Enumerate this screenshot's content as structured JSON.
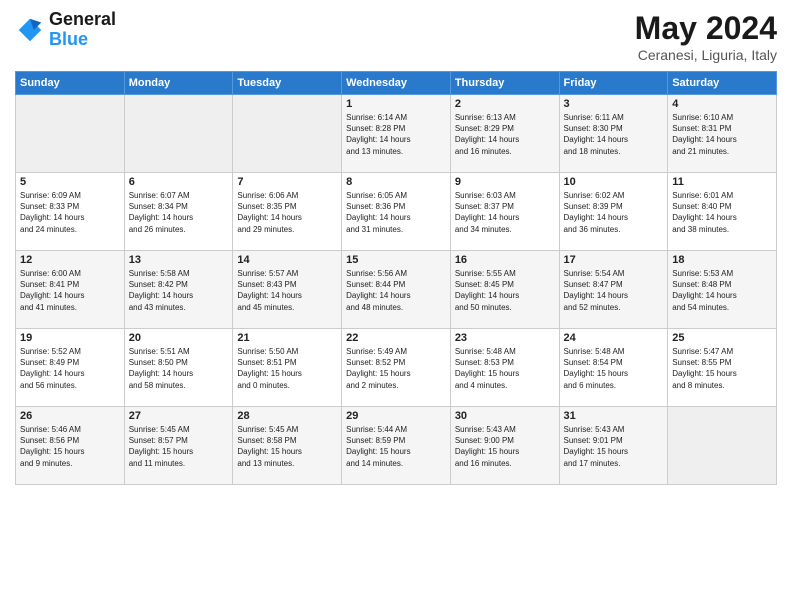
{
  "header": {
    "logo_text_general": "General",
    "logo_text_blue": "Blue",
    "title": "May 2024",
    "subtitle": "Ceranesi, Liguria, Italy"
  },
  "weekdays": [
    "Sunday",
    "Monday",
    "Tuesday",
    "Wednesday",
    "Thursday",
    "Friday",
    "Saturday"
  ],
  "weeks": [
    [
      {
        "day": "",
        "info": ""
      },
      {
        "day": "",
        "info": ""
      },
      {
        "day": "",
        "info": ""
      },
      {
        "day": "1",
        "info": "Sunrise: 6:14 AM\nSunset: 8:28 PM\nDaylight: 14 hours\nand 13 minutes."
      },
      {
        "day": "2",
        "info": "Sunrise: 6:13 AM\nSunset: 8:29 PM\nDaylight: 14 hours\nand 16 minutes."
      },
      {
        "day": "3",
        "info": "Sunrise: 6:11 AM\nSunset: 8:30 PM\nDaylight: 14 hours\nand 18 minutes."
      },
      {
        "day": "4",
        "info": "Sunrise: 6:10 AM\nSunset: 8:31 PM\nDaylight: 14 hours\nand 21 minutes."
      }
    ],
    [
      {
        "day": "5",
        "info": "Sunrise: 6:09 AM\nSunset: 8:33 PM\nDaylight: 14 hours\nand 24 minutes."
      },
      {
        "day": "6",
        "info": "Sunrise: 6:07 AM\nSunset: 8:34 PM\nDaylight: 14 hours\nand 26 minutes."
      },
      {
        "day": "7",
        "info": "Sunrise: 6:06 AM\nSunset: 8:35 PM\nDaylight: 14 hours\nand 29 minutes."
      },
      {
        "day": "8",
        "info": "Sunrise: 6:05 AM\nSunset: 8:36 PM\nDaylight: 14 hours\nand 31 minutes."
      },
      {
        "day": "9",
        "info": "Sunrise: 6:03 AM\nSunset: 8:37 PM\nDaylight: 14 hours\nand 34 minutes."
      },
      {
        "day": "10",
        "info": "Sunrise: 6:02 AM\nSunset: 8:39 PM\nDaylight: 14 hours\nand 36 minutes."
      },
      {
        "day": "11",
        "info": "Sunrise: 6:01 AM\nSunset: 8:40 PM\nDaylight: 14 hours\nand 38 minutes."
      }
    ],
    [
      {
        "day": "12",
        "info": "Sunrise: 6:00 AM\nSunset: 8:41 PM\nDaylight: 14 hours\nand 41 minutes."
      },
      {
        "day": "13",
        "info": "Sunrise: 5:58 AM\nSunset: 8:42 PM\nDaylight: 14 hours\nand 43 minutes."
      },
      {
        "day": "14",
        "info": "Sunrise: 5:57 AM\nSunset: 8:43 PM\nDaylight: 14 hours\nand 45 minutes."
      },
      {
        "day": "15",
        "info": "Sunrise: 5:56 AM\nSunset: 8:44 PM\nDaylight: 14 hours\nand 48 minutes."
      },
      {
        "day": "16",
        "info": "Sunrise: 5:55 AM\nSunset: 8:45 PM\nDaylight: 14 hours\nand 50 minutes."
      },
      {
        "day": "17",
        "info": "Sunrise: 5:54 AM\nSunset: 8:47 PM\nDaylight: 14 hours\nand 52 minutes."
      },
      {
        "day": "18",
        "info": "Sunrise: 5:53 AM\nSunset: 8:48 PM\nDaylight: 14 hours\nand 54 minutes."
      }
    ],
    [
      {
        "day": "19",
        "info": "Sunrise: 5:52 AM\nSunset: 8:49 PM\nDaylight: 14 hours\nand 56 minutes."
      },
      {
        "day": "20",
        "info": "Sunrise: 5:51 AM\nSunset: 8:50 PM\nDaylight: 14 hours\nand 58 minutes."
      },
      {
        "day": "21",
        "info": "Sunrise: 5:50 AM\nSunset: 8:51 PM\nDaylight: 15 hours\nand 0 minutes."
      },
      {
        "day": "22",
        "info": "Sunrise: 5:49 AM\nSunset: 8:52 PM\nDaylight: 15 hours\nand 2 minutes."
      },
      {
        "day": "23",
        "info": "Sunrise: 5:48 AM\nSunset: 8:53 PM\nDaylight: 15 hours\nand 4 minutes."
      },
      {
        "day": "24",
        "info": "Sunrise: 5:48 AM\nSunset: 8:54 PM\nDaylight: 15 hours\nand 6 minutes."
      },
      {
        "day": "25",
        "info": "Sunrise: 5:47 AM\nSunset: 8:55 PM\nDaylight: 15 hours\nand 8 minutes."
      }
    ],
    [
      {
        "day": "26",
        "info": "Sunrise: 5:46 AM\nSunset: 8:56 PM\nDaylight: 15 hours\nand 9 minutes."
      },
      {
        "day": "27",
        "info": "Sunrise: 5:45 AM\nSunset: 8:57 PM\nDaylight: 15 hours\nand 11 minutes."
      },
      {
        "day": "28",
        "info": "Sunrise: 5:45 AM\nSunset: 8:58 PM\nDaylight: 15 hours\nand 13 minutes."
      },
      {
        "day": "29",
        "info": "Sunrise: 5:44 AM\nSunset: 8:59 PM\nDaylight: 15 hours\nand 14 minutes."
      },
      {
        "day": "30",
        "info": "Sunrise: 5:43 AM\nSunset: 9:00 PM\nDaylight: 15 hours\nand 16 minutes."
      },
      {
        "day": "31",
        "info": "Sunrise: 5:43 AM\nSunset: 9:01 PM\nDaylight: 15 hours\nand 17 minutes."
      },
      {
        "day": "",
        "info": ""
      }
    ]
  ]
}
